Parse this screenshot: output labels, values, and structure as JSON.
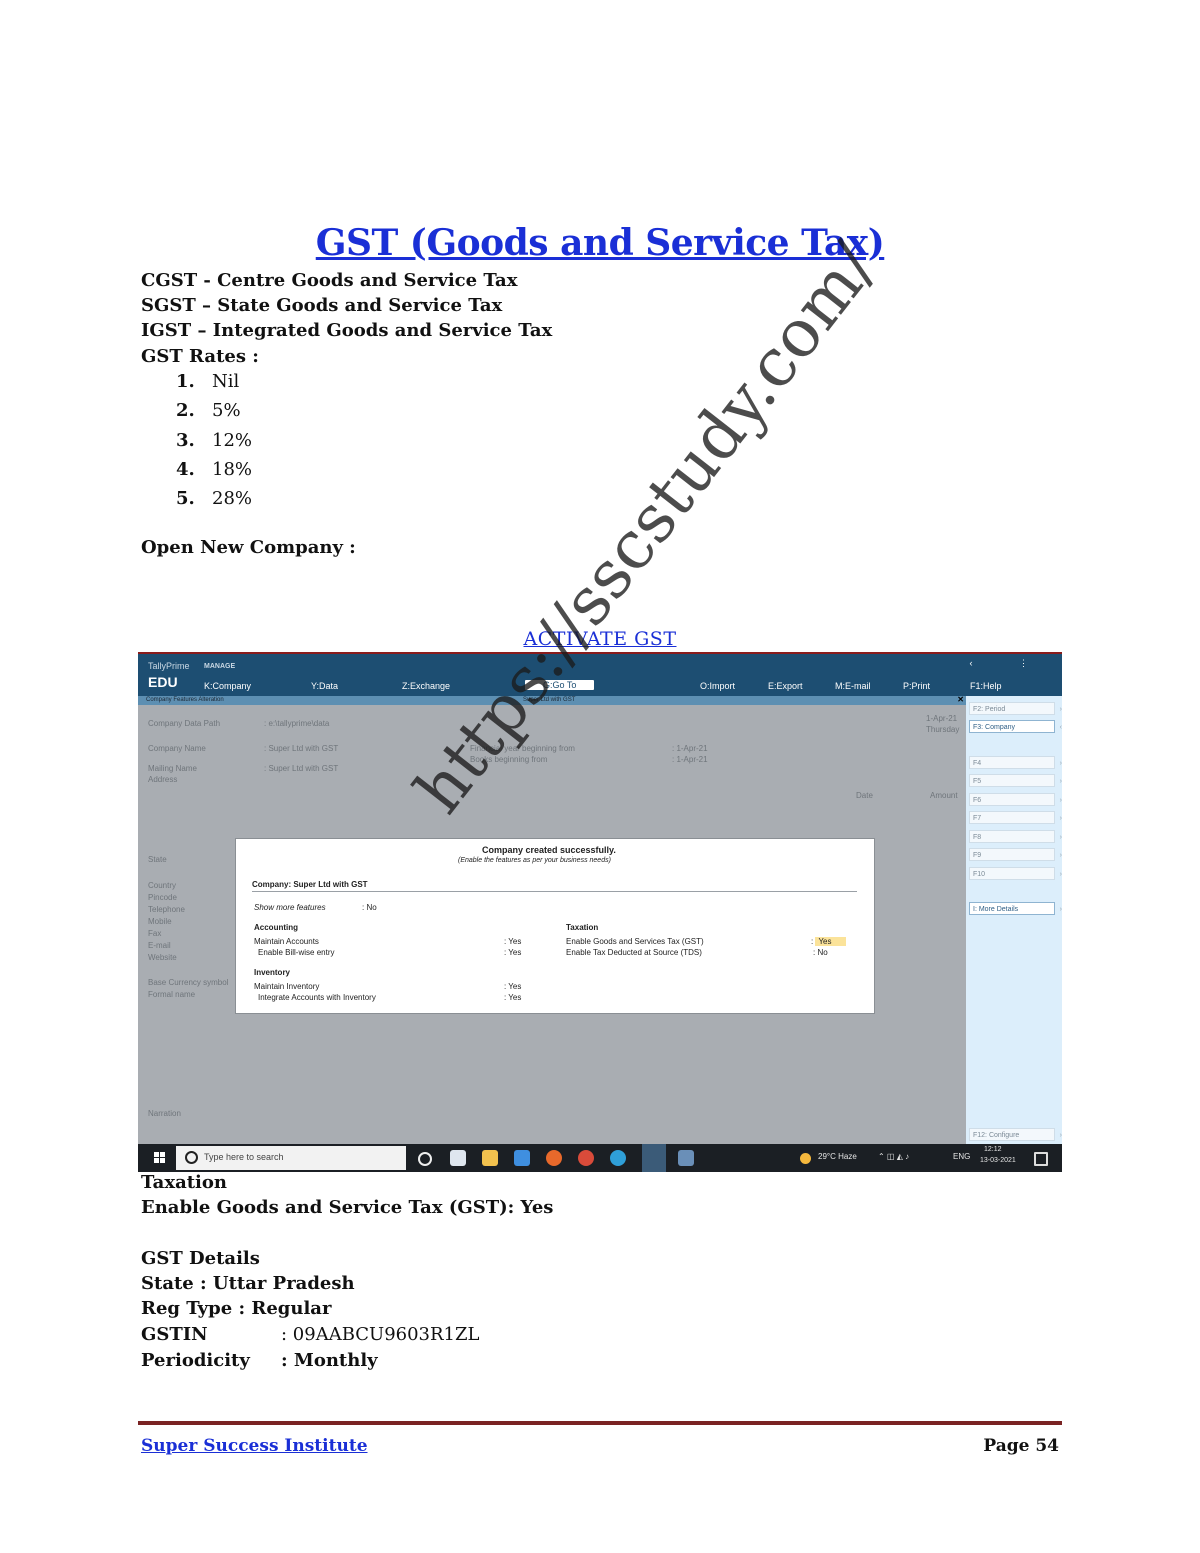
{
  "title": "GST (Goods and Service Tax)",
  "definitions": [
    "CGST - Centre Goods and Service Tax",
    "SGST – State Goods and Service Tax",
    "IGST – Integrated Goods and Service Tax",
    "GST Rates :"
  ],
  "rates": [
    {
      "num": "1.",
      "value": "Nil"
    },
    {
      "num": "2.",
      "value": "5%"
    },
    {
      "num": "3.",
      "value": "12%"
    },
    {
      "num": "4.",
      "value": "18%"
    },
    {
      "num": "5.",
      "value": "28%"
    }
  ],
  "open_company": "Open New Company :",
  "activate_heading": "ACTIVATE GST",
  "screenshot": {
    "brand_small": "TallyPrime",
    "brand_big": "EDU",
    "manage": "MANAGE",
    "menu": {
      "company": "K:Company",
      "data": "Y:Data",
      "exchange": "Z:Exchange",
      "goto": "G:Go To",
      "import": "O:Import",
      "export": "E:Export",
      "email": "M:E-mail",
      "print": "P:Print",
      "help": "F1:Help"
    },
    "subbar_left": "Company Features Alteration",
    "subbar_mid": "Super Ltd with GST",
    "bg": {
      "company_data_path": "Company Data Path",
      "data_path_value": ": e:\\tallyprime\\data",
      "company_name": "Company Name",
      "company_name_value": ": Super Ltd with GST",
      "mailing_name": "Mailing Name",
      "mailing_name_value": ": Super Ltd with GST",
      "address": "Address",
      "fy_beginning": "Financial year beginning from",
      "books_beginning": "Books beginning from",
      "fy_value": ": 1-Apr-21",
      "books_value": ": 1-Apr-21",
      "date": "1-Apr-21",
      "day": "Thursday",
      "state": "State",
      "country": "Country",
      "pincode": "Pincode",
      "telephone": "Telephone",
      "mobile": "Mobile",
      "fax": "Fax",
      "email": "E-mail",
      "website": "Website",
      "base_currency": "Base Currency symbol",
      "formal_name": "Formal name",
      "narration": "Narration",
      "date_col": "Date",
      "amount_col": "Amount"
    },
    "fkeys": [
      "F2: Period",
      "F3: Company",
      "F4",
      "F5",
      "F6",
      "F7",
      "F8",
      "F9",
      "F10",
      "I: More Details",
      "F12: Configure"
    ],
    "dialog": {
      "heading": "Company created successfully.",
      "subheading": "(Enable the features as per your business needs)",
      "company": "Company: Super Ltd with GST",
      "show_more_label": "Show more features",
      "show_more_value": ": No",
      "accounting": "Accounting",
      "maintain_accounts": "Maintain Accounts",
      "maintain_accounts_value": ": Yes",
      "bill_wise": "Enable Bill-wise entry",
      "bill_wise_value": ": Yes",
      "inventory": "Inventory",
      "maintain_inventory": "Maintain Inventory",
      "maintain_inventory_value": ": Yes",
      "integrate": "Integrate Accounts with Inventory",
      "integrate_value": ": Yes",
      "taxation": "Taxation",
      "enable_gst": "Enable Goods and Services Tax (GST)",
      "enable_gst_value": "Yes",
      "enable_tds": "Enable Tax Deducted at Source (TDS)",
      "enable_tds_value": ": No"
    },
    "taskbar": {
      "search_placeholder": "Type here to search",
      "weather": "29°C Haze",
      "lang": "ENG",
      "time": "12:12",
      "date": "13-03-2021"
    }
  },
  "after": [
    "Taxation",
    "Enable Goods and Service Tax (GST): Yes",
    "GST Details",
    "State : Uttar Pradesh",
    "Reg Type : Regular"
  ],
  "gstin": {
    "label": "GSTIN",
    "value": ": 09AABCU9603R1ZL"
  },
  "periodicity": {
    "label": "Periodicity",
    "value": ": Monthly"
  },
  "watermark": "https://sscstudy.com/",
  "footer": {
    "left": "Super Success Institute",
    "right": "Page 54"
  },
  "colors": {
    "link_blue": "#1a2fd6",
    "rule": "#7a2323",
    "tally_blue": "#1d4e72"
  }
}
